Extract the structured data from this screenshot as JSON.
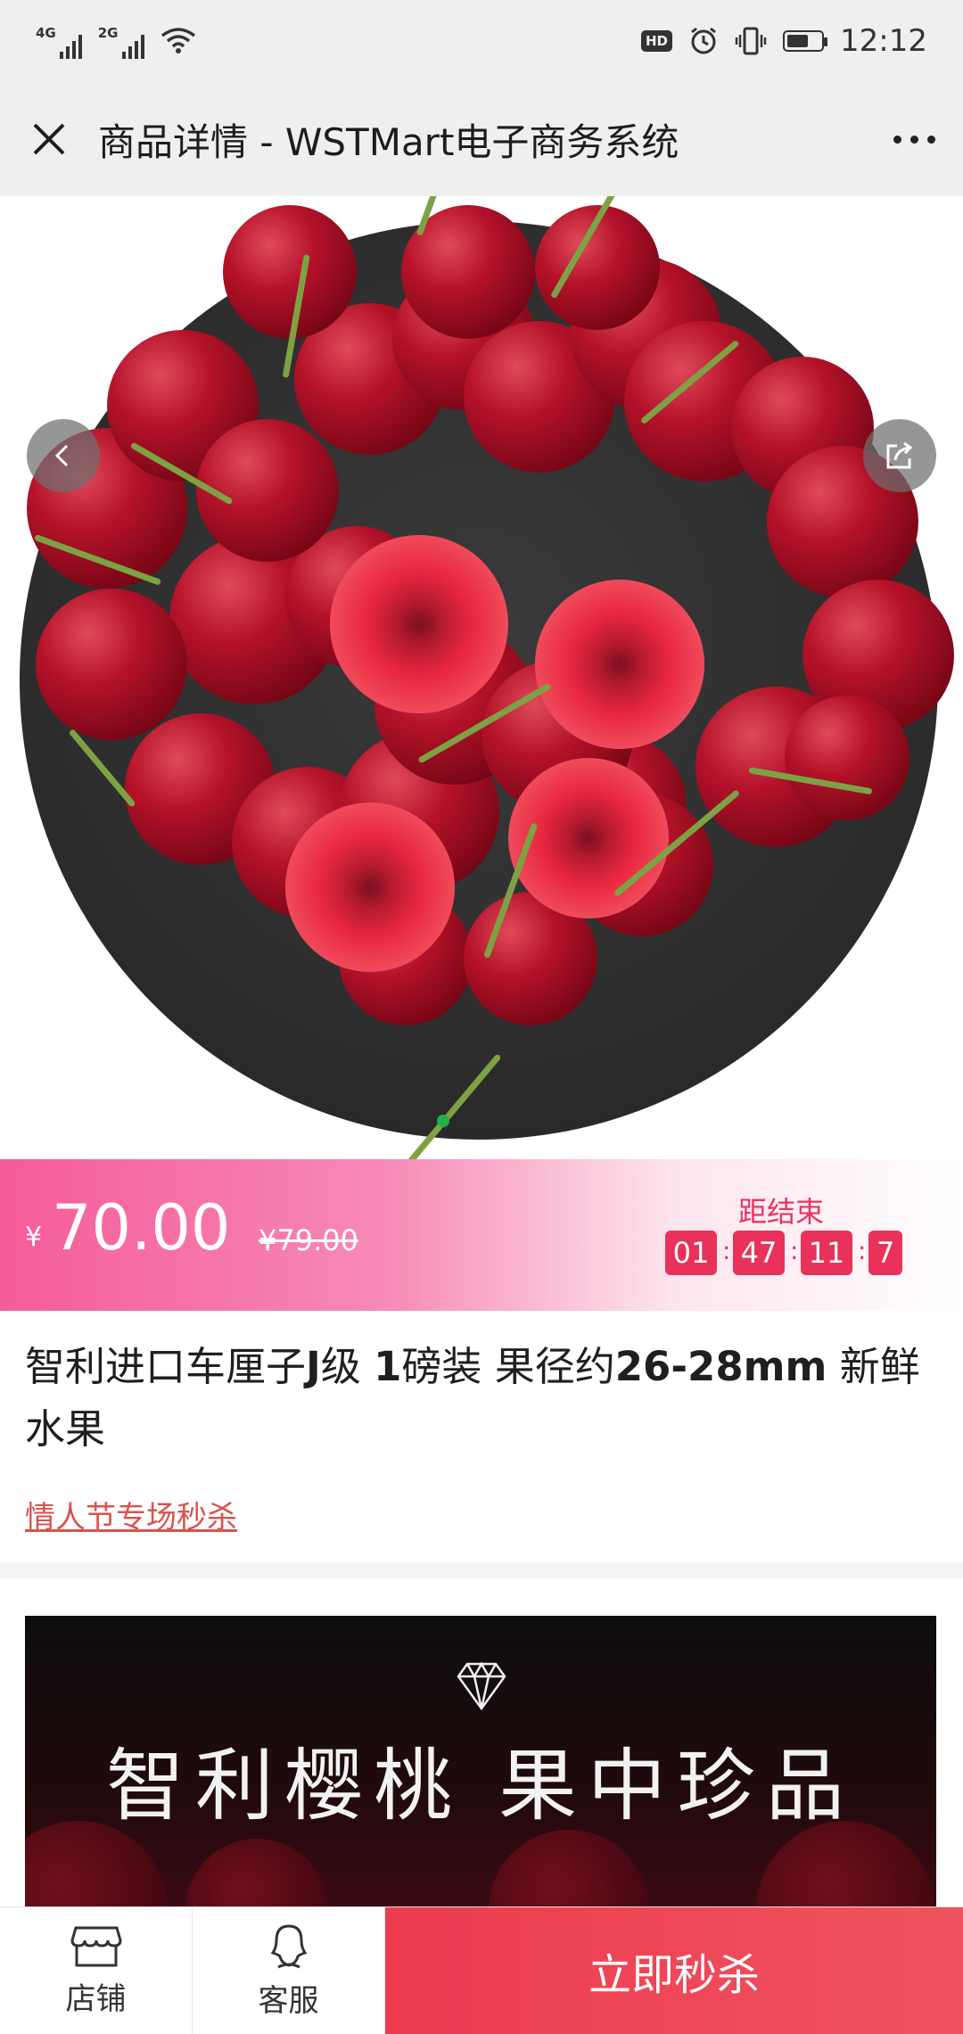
{
  "status_bar": {
    "net1_label": "4G",
    "net2_label": "2G",
    "hd_label": "HD",
    "time": "12:12"
  },
  "nav": {
    "title": "商品详情 - WSTMart电子商务系统"
  },
  "price": {
    "currency": "¥",
    "current": "70.00",
    "original": "¥79.00"
  },
  "countdown": {
    "label": "距结束",
    "hours": "01",
    "minutes": "47",
    "seconds": "11",
    "tenths": "7"
  },
  "product": {
    "title_parts": [
      "智利进口车厘子",
      "J",
      "级 ",
      "1",
      "磅装 果径约",
      "26-28mm",
      " 新鲜水果"
    ],
    "promo": "情人节专场秒杀"
  },
  "detail": {
    "banner_text": "智利樱桃 果中珍品"
  },
  "bottom_bar": {
    "shop_label": "店铺",
    "service_label": "客服",
    "buy_label": "立即秒杀"
  },
  "colors": {
    "accent_pink": "#f55c9a",
    "countdown_red": "#e8325a",
    "buy_red": "#ec3b50",
    "promo_link": "#d9534f",
    "carousel_dot": "#22b14c"
  },
  "icons": {
    "close": "close-icon",
    "more": "more-icon",
    "back": "back-icon",
    "share": "share-icon",
    "shop": "shop-icon",
    "service": "service-icon",
    "diamond": "diamond-icon"
  }
}
